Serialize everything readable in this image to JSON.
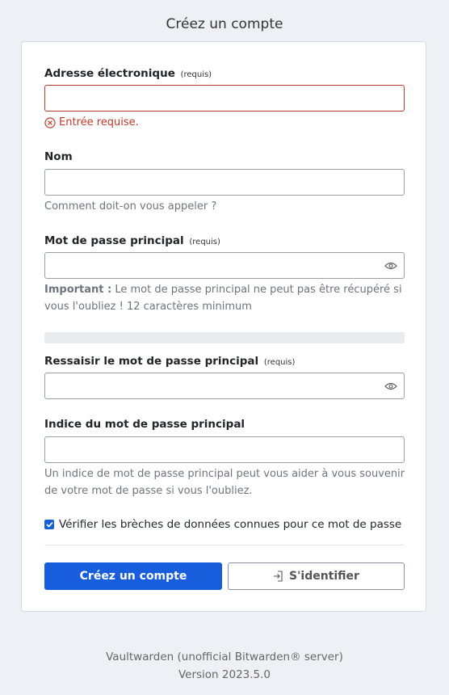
{
  "page": {
    "title": "Créez un compte"
  },
  "form": {
    "email": {
      "label": "Adresse électronique",
      "required": "(requis)",
      "value": "",
      "error": "Entrée requise."
    },
    "name": {
      "label": "Nom",
      "value": "",
      "help": "Comment doit-on vous appeler ?"
    },
    "master_password": {
      "label": "Mot de passe principal",
      "required": "(requis)",
      "value": "",
      "help_strong": "Important :",
      "help": "Le mot de passe principal ne peut pas être récupéré si vous l'oubliez ! 12 caractères minimum",
      "strength_fraction": 0
    },
    "retype_password": {
      "label": "Ressaisir le mot de passe principal",
      "required": "(requis)",
      "value": ""
    },
    "hint": {
      "label": "Indice du mot de passe principal",
      "value": "",
      "help": "Un indice de mot de passe principal peut vous aider à vous souvenir de votre mot de passe si vous l'oubliez."
    },
    "breach_check": {
      "label": "Vérifier les brèches de données connues pour ce mot de passe",
      "checked": true
    },
    "submit_label": "Créez un compte",
    "login_label": "S'identifier"
  },
  "footer": {
    "line1": "Vaultwarden (unofficial Bitwarden® server)",
    "line2": "Version 2023.5.0"
  },
  "colors": {
    "primary": "#175ddc",
    "error": "#c0392b",
    "background": "#edf0f4"
  },
  "icons": {
    "error": "error-circle-icon",
    "toggle_visibility": "eye-icon",
    "login": "sign-in-icon",
    "checkbox": "checkmark-icon"
  }
}
